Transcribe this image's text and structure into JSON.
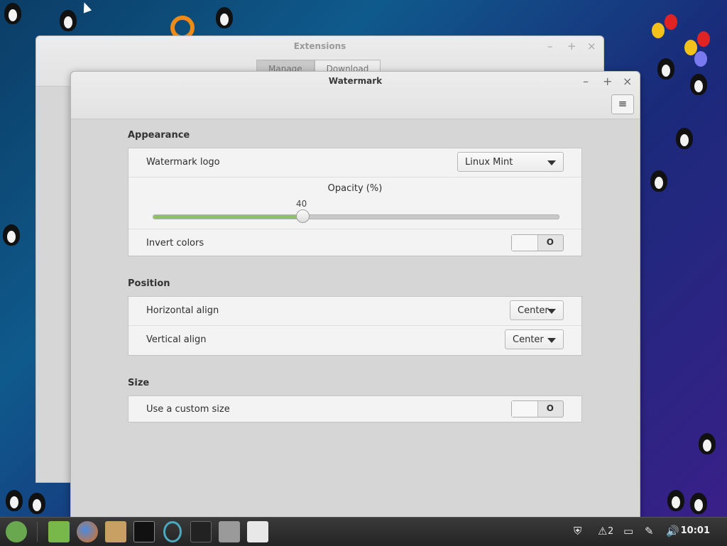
{
  "desktop": {
    "taskbar": {
      "clock": "10:01",
      "notifications_count": "2"
    }
  },
  "extensions_window": {
    "title": "Extensions",
    "tabs": [
      "Manage",
      "Download"
    ],
    "controls": {
      "minimize": "–",
      "maximize": "+",
      "close": "×"
    }
  },
  "watermark_window": {
    "title": "Watermark",
    "controls": {
      "minimize": "–",
      "maximize": "+",
      "close": "×"
    },
    "menu_icon": "≡",
    "appearance": {
      "section_title": "Appearance",
      "logo_label": "Watermark logo",
      "logo_value": "Linux Mint",
      "opacity_label": "Opacity (%)",
      "opacity_value": "40",
      "invert_label": "Invert colors",
      "invert_state": "O"
    },
    "position": {
      "section_title": "Position",
      "horizontal_label": "Horizontal align",
      "horizontal_value": "Center",
      "vertical_label": "Vertical align",
      "vertical_value": "Center"
    },
    "size": {
      "section_title": "Size",
      "custom_size_label": "Use a custom size",
      "custom_size_state": "O"
    }
  },
  "colors": {
    "slider_fill": "#8fc067",
    "window_bg": "#d6d6d6",
    "panel_bg": "#f3f3f3"
  },
  "icons": {
    "taskbar": [
      "mint-menu-icon",
      "folder-icon",
      "firefox-icon",
      "package-icon",
      "terminal-icon",
      "ring-icon",
      "penguin-app-icon",
      "settings-icon",
      "window-icon"
    ],
    "tray": [
      "shield-icon",
      "notification-icon",
      "display-icon",
      "pen-icon",
      "volume-icon"
    ]
  }
}
